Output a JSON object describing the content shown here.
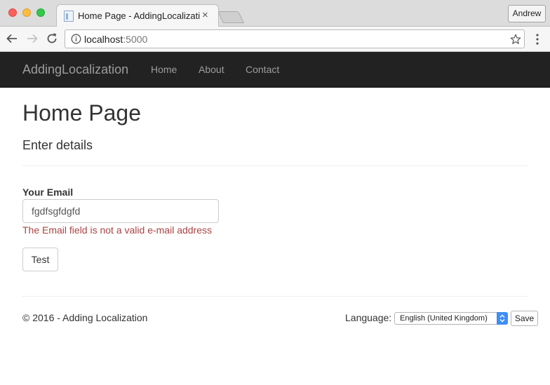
{
  "browser": {
    "tab_title": "Home Page - AddingLocalizati",
    "tab_close": "×",
    "profile_name": "Andrew",
    "url_host": "localhost",
    "url_port": ":5000"
  },
  "navbar": {
    "brand": "AddingLocalization",
    "links": [
      {
        "label": "Home"
      },
      {
        "label": "About"
      },
      {
        "label": "Contact"
      }
    ]
  },
  "main": {
    "title": "Home Page",
    "subtitle": "Enter details",
    "form": {
      "email_label": "Your Email",
      "email_value": "fgdfsgfdgfd",
      "error_message": "The Email field is not a valid e-mail address",
      "submit_label": "Test"
    }
  },
  "footer": {
    "copyright": "© 2016 - Adding Localization",
    "language_label": "Language:",
    "language_selected": "English (United Kingdom)",
    "save_label": "Save"
  },
  "colors": {
    "navbar_bg": "#222222",
    "navbar_text": "#9d9d9d",
    "error_text": "#a94442",
    "select_accent": "#3f8ef5"
  }
}
